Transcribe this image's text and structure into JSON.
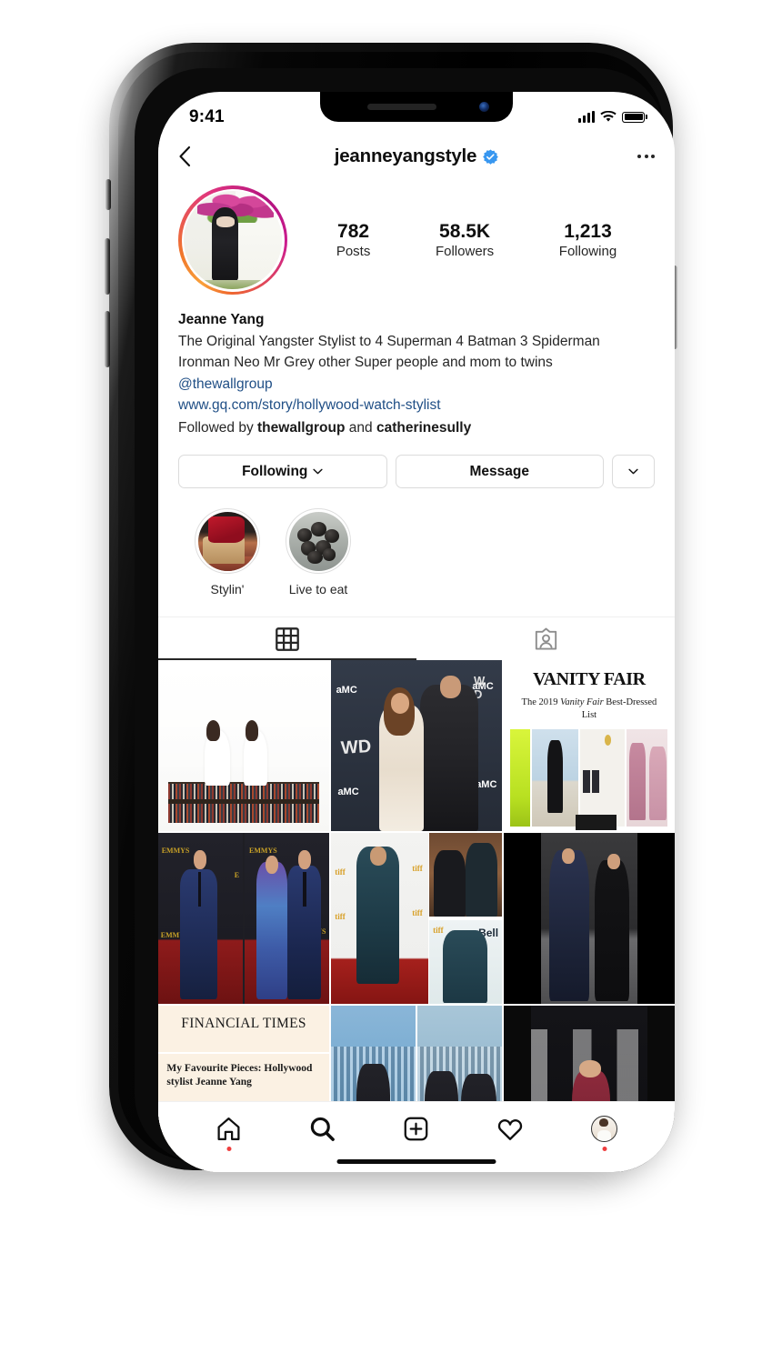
{
  "status_bar": {
    "time": "9:41",
    "signal_icon": "signal-bars-icon",
    "wifi_icon": "wifi-icon",
    "battery_icon": "battery-full-icon"
  },
  "header": {
    "back_icon": "chevron-left-icon",
    "username": "jeanneyangstyle",
    "verified_icon": "verified-badge-icon",
    "more_icon": "more-options-icon"
  },
  "profile": {
    "avatar_icon": "profile-avatar",
    "has_story_ring": true,
    "stats": [
      {
        "value": "782",
        "label": "Posts"
      },
      {
        "value": "58.5K",
        "label": "Followers"
      },
      {
        "value": "1,213",
        "label": "Following"
      }
    ],
    "display_name": "Jeanne Yang",
    "bio_line_1": "The Original Yangster Stylist to 4 Superman 4 Batman 3 Spiderman",
    "bio_line_2": "Ironman Neo Mr Grey other Super people and mom to twins",
    "mention": "@thewallgroup",
    "website": "www.gq.com/story/hollywood-watch-stylist",
    "followed_by_prefix": "Followed by ",
    "followed_by_user_1": "thewallgroup",
    "followed_by_joiner": " and ",
    "followed_by_user_2": "catherinesully"
  },
  "actions": {
    "following_label": "Following",
    "following_chevron_icon": "chevron-down-icon",
    "message_label": "Message",
    "dropdown_icon": "chevron-down-icon"
  },
  "highlights": [
    {
      "label": "Stylin'",
      "icon": "highlight-cover-stylin"
    },
    {
      "label": "Live to eat",
      "icon": "highlight-cover-live-to-eat"
    }
  ],
  "tabs": [
    {
      "name": "grid",
      "icon": "grid-icon",
      "active": true
    },
    {
      "name": "tagged",
      "icon": "tagged-person-icon",
      "active": false
    }
  ],
  "grid_posts": [
    {
      "id": 1,
      "description": "Two girls in white dresses sitting on bookshelf"
    },
    {
      "id": 2,
      "description": "Couple on AMC Walking Dead red carpet"
    },
    {
      "id": 3,
      "description": "Vanity Fair 2019 Best-Dressed List",
      "title": "VANITY FAIR",
      "subtitle_pre": "The 2019 ",
      "subtitle_italic": "Vanity Fair",
      "subtitle_post": " Best-Dressed List"
    },
    {
      "id": 4,
      "description": "Emmys red carpet, blue suits and floral gown"
    },
    {
      "id": 5,
      "description": "TIFF red carpet collage, teal suit"
    },
    {
      "id": 6,
      "description": "Couple at night on street, navy suit and black dress"
    },
    {
      "id": 7,
      "description": "Financial Times article",
      "title": "FINANCIAL TIMES",
      "headline": "My Favourite Pieces: Hollywood stylist Jeanne Yang"
    },
    {
      "id": 8,
      "description": "Blue carpet portraits, two men"
    },
    {
      "id": 9,
      "description": "Dark step-and-repeat event photo"
    }
  ],
  "bottom_nav": [
    {
      "name": "home",
      "icon": "home-icon",
      "badge": true
    },
    {
      "name": "search",
      "icon": "search-icon",
      "badge": false
    },
    {
      "name": "create",
      "icon": "add-post-icon",
      "badge": false
    },
    {
      "name": "activity",
      "icon": "heart-icon",
      "badge": false
    },
    {
      "name": "profile",
      "icon": "profile-avatar-icon",
      "badge": true
    }
  ],
  "colors": {
    "verified_blue": "#3897F0",
    "link_blue": "#204f86",
    "badge_red": "#ef3e3e",
    "text_primary": "#262626"
  }
}
